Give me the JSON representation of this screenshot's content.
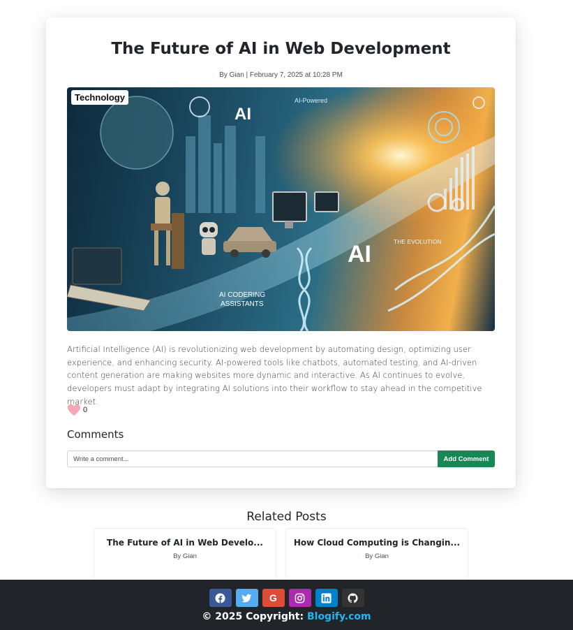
{
  "post": {
    "title": "The Future of AI in Web Development",
    "meta": "By Gian | February 7, 2025 at 10:28 PM",
    "category": "Technology",
    "body": "Artificial Intelligence (AI) is revolutionizing web development by automating design, optimizing user experience, and enhancing security. AI-powered tools like chatbots, automated testing, and AI-driven content generation are making websites more dynamic and interactive. As AI continues to evolve, developers must adapt by integrating AI solutions into their workflow to stay ahead in the competitive market.",
    "likes": "0"
  },
  "hero_image": {
    "text_ai_1": "AI",
    "text_ai_2": "AI",
    "text_powered": "AI-Powered",
    "text_evolution": "THE EVOLUTION",
    "text_coding": "AI CODERING",
    "text_assistants": "ASSISTANTS"
  },
  "comments": {
    "heading": "Comments",
    "placeholder": "Write a comment...",
    "button_label": "Add Comment"
  },
  "related": {
    "heading": "Related Posts",
    "items": [
      {
        "title": "The Future of AI in Web Develo...",
        "author": "By Gian"
      },
      {
        "title": "How Cloud Computing is Changin...",
        "author": "By Gian"
      }
    ]
  },
  "footer": {
    "social": [
      {
        "name": "facebook",
        "color": "#3b5998"
      },
      {
        "name": "twitter",
        "color": "#55acee"
      },
      {
        "name": "google",
        "color": "#dd4b39",
        "glyph": "G"
      },
      {
        "name": "instagram",
        "color": "#ac2bac"
      },
      {
        "name": "linkedin",
        "color": "#0082ca"
      },
      {
        "name": "github",
        "color": "#333333"
      }
    ],
    "copyright_prefix": "© 2025 Copyright: ",
    "brand": "Blogify.com"
  }
}
